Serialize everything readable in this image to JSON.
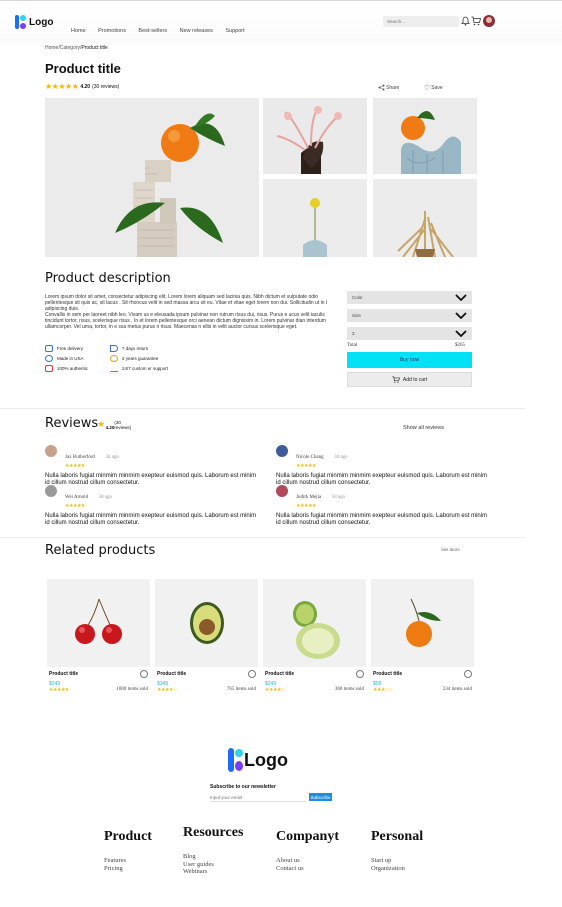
{
  "header": {
    "logo_text": "Logo",
    "nav": [
      "Home",
      "Promotions",
      "Best-sellers",
      "New releases",
      "Support"
    ],
    "search_placeholder": "Search..."
  },
  "breadcrumb": {
    "path": "Home/Category/",
    "current": "Product title"
  },
  "product": {
    "title": "Product title",
    "rating": "4.20",
    "reviews_count": "(30 reviews)",
    "share_label": "Share",
    "save_label": "Save"
  },
  "description": {
    "heading": "Product description",
    "text": "Lorem ipsum dolor sit amet, consectetur adipiscing elit. Lorem lorem aliquam sed lacinia quis. Nibh dictum et vulputate odio pellentesque sit quis ac, sit lacus . Sit rhoncus velit in sed massa arcu sit eu. Vitae et vitae eget lorem non dui. Sollicitudin ut in I adipiscing duis.",
    "text2": "Convallis in sem per laoreet nibh leo. Vivam us e eleusada ipsum pulvinar non rutrum risus dui, risus. Purus e ucus velit iaculis tincidunt tortor, risus, scelerisque risus . In et lorem pellentesque orci aenean dictum dignissim in. Lorem pulvinar dian interdum ullamcorper. Vel urna, tortor, in e ssa metus purus n risus. Maecenas n ellis in velit auctor cursus scelerisque eget."
  },
  "features": [
    {
      "icon": "truck-icon",
      "label": "Free delivery"
    },
    {
      "icon": "return-icon",
      "label": "7 days return"
    },
    {
      "icon": "globe-icon",
      "label": "Made in USA"
    },
    {
      "icon": "medal-icon",
      "label": "2 years guarantee"
    },
    {
      "icon": "card-icon",
      "label": "100% authentic"
    },
    {
      "icon": "support-icon",
      "label": "24/7 custom er support"
    }
  ],
  "purchase": {
    "color_label": "Color",
    "size_label": "Size",
    "quantity": "3",
    "total_label": "Total",
    "total_value": "$265",
    "buy_label": "Buy now",
    "cart_label": "Add to cart"
  },
  "reviews": {
    "heading": "Reviews",
    "rating": "4.20",
    "count": "(30 reviews)",
    "show_all": "Show all reviews",
    "items": [
      {
        "name": "Jax Rutherford",
        "date": "3d ago",
        "text": "Nulla laboris fugiat minmim minmim exepteur euismod quis. Laborum est minim id cillum nostrud cillum consectetur."
      },
      {
        "name": "Nicole Chang",
        "date": "3d ago",
        "text": "Nulla laboris fugiat minmim minmim exepteur euismod quis. Laborum est minim id cillum nostrud cillum consectetur."
      },
      {
        "name": "Wei Arnold",
        "date": "3d ago",
        "text": "Nulla laboris fugiat minmim minmim exepteur euismod quis. Laborum est minim id cillum nostrud cillum consectetur."
      },
      {
        "name": "Judith Mejia",
        "date": "3d ago",
        "text": "Nulla laboris fugiat minmim minmim exepteur euismod quis. Laborum est minim id cillum nostrud cillum consectetur."
      }
    ]
  },
  "related": {
    "heading": "Related products",
    "see_more": "See more",
    "items": [
      {
        "title": "Product title",
        "price": "$249",
        "sold": "1000 items sold",
        "stars": "★★★★★"
      },
      {
        "title": "Product title",
        "price": "$349",
        "sold": "765 items sold",
        "stars": "★★★★☆"
      },
      {
        "title": "Product title",
        "price": "$249",
        "sold": "360 items sold",
        "stars": "★★★★☆"
      },
      {
        "title": "Product title",
        "price": "$99",
        "sold": "234 items sold",
        "stars": "★★★☆☆"
      }
    ]
  },
  "footer": {
    "logo_text": "Logo",
    "newsletter_label": "Subscribe to our newsletter",
    "email_placeholder": "Input your email",
    "subscribe_label": "Subscribe",
    "columns": [
      {
        "heading": "Product",
        "links": [
          "Features",
          "Pricing"
        ]
      },
      {
        "heading": "Resources",
        "links": [
          "Blog",
          "User guides",
          "Webinars"
        ]
      },
      {
        "heading": "Companyt",
        "links": [
          "About us",
          "Contact us"
        ]
      },
      {
        "heading": "Personal",
        "links": [
          "Start up",
          "Organization"
        ]
      }
    ]
  },
  "colors": {
    "accent": "#00E1F5",
    "star": "#F5B800",
    "price": "#22B7E6",
    "logo_blue": "#1E6BFF"
  }
}
